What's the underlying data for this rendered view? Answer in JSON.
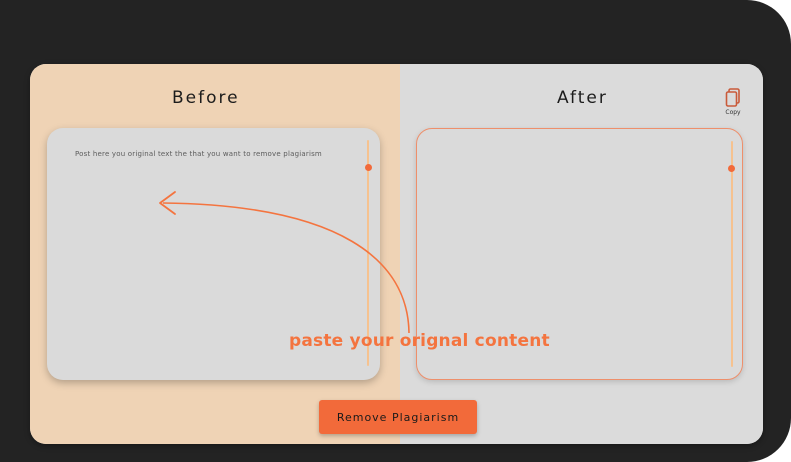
{
  "panels": {
    "before": {
      "title": "Before",
      "placeholder": "Post here you original text the that you want to remove plagiarism"
    },
    "after": {
      "title": "After",
      "copy_label": "Copy"
    }
  },
  "hint": {
    "text": "paste your orignal content"
  },
  "actions": {
    "remove_label": "Remove Plagiarism"
  },
  "icons": {
    "copy": "copy-icon",
    "hint_arrow": "curved-arrow-icon"
  },
  "colors": {
    "accent": "#f26a3a",
    "before_bg": "#efd3b5",
    "after_bg": "#dbdbdb",
    "frame": "#232323"
  }
}
